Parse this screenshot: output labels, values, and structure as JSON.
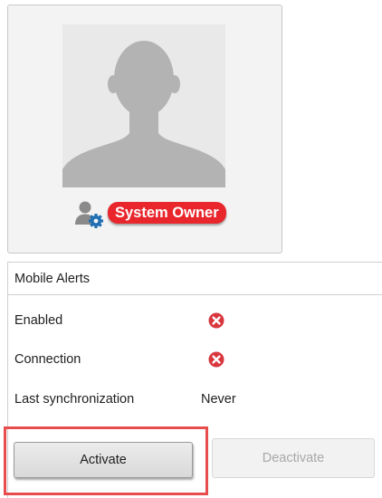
{
  "profile": {
    "role_badge": "System Owner",
    "avatar_icon": "user-silhouette-icon",
    "role_icon": "user-gear-icon"
  },
  "mobile_alerts": {
    "title": "Mobile Alerts",
    "rows": [
      {
        "label": "Enabled",
        "status_icon": "red-x-circle-icon"
      },
      {
        "label": "Connection",
        "status_icon": "red-x-circle-icon"
      },
      {
        "label": "Last synchronization",
        "value": "Never"
      }
    ]
  },
  "buttons": {
    "activate_label": "Activate",
    "deactivate_label": "Deactivate"
  },
  "colors": {
    "badge_red": "#e8262c",
    "error_red": "#d9363e",
    "highlight_red": "#e84c4c",
    "gear_blue": "#1f6fb2"
  }
}
